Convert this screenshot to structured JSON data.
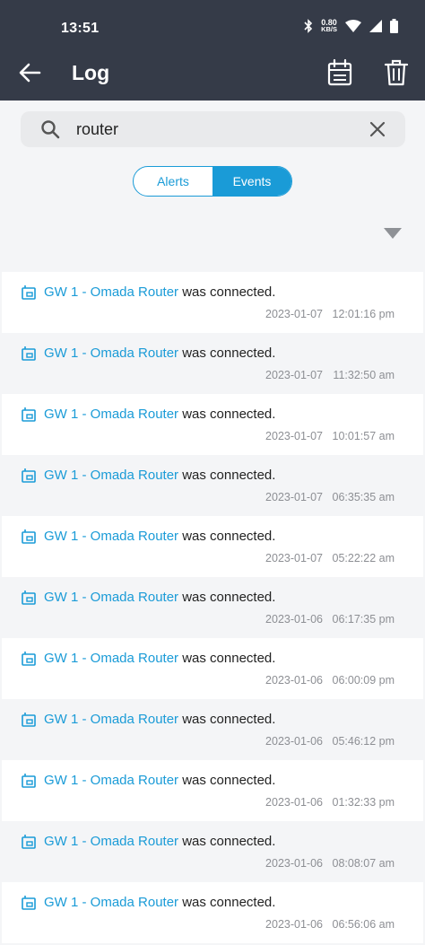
{
  "status_bar": {
    "time": "13:51",
    "speed_value": "0.80",
    "speed_unit": "KB/S"
  },
  "header": {
    "title": "Log"
  },
  "search": {
    "value": "router"
  },
  "tabs": [
    {
      "label": "Alerts"
    },
    {
      "label": "Events"
    }
  ],
  "colors": {
    "appbar": "#353b48",
    "accent": "#1a9bd7",
    "text": "#222222",
    "muted": "#8d8f94"
  },
  "events": [
    {
      "device": "GW 1 - Omada Router",
      "message": " was connected.",
      "date": "2023-01-07",
      "time": "12:01:16 pm"
    },
    {
      "device": "GW 1 - Omada Router",
      "message": " was connected.",
      "date": "2023-01-07",
      "time": "11:32:50 am"
    },
    {
      "device": "GW 1 - Omada Router",
      "message": " was connected.",
      "date": "2023-01-07",
      "time": "10:01:57 am"
    },
    {
      "device": "GW 1 - Omada Router",
      "message": " was connected.",
      "date": "2023-01-07",
      "time": "06:35:35 am"
    },
    {
      "device": "GW 1 - Omada Router",
      "message": " was connected.",
      "date": "2023-01-07",
      "time": "05:22:22 am"
    },
    {
      "device": "GW 1 - Omada Router",
      "message": " was connected.",
      "date": "2023-01-06",
      "time": "06:17:35 pm"
    },
    {
      "device": "GW 1 - Omada Router",
      "message": " was connected.",
      "date": "2023-01-06",
      "time": "06:00:09 pm"
    },
    {
      "device": "GW 1 - Omada Router",
      "message": " was connected.",
      "date": "2023-01-06",
      "time": "05:46:12 pm"
    },
    {
      "device": "GW 1 - Omada Router",
      "message": " was connected.",
      "date": "2023-01-06",
      "time": "01:32:33 pm"
    },
    {
      "device": "GW 1 - Omada Router",
      "message": " was connected.",
      "date": "2023-01-06",
      "time": "08:08:07 am"
    },
    {
      "device": "GW 1 - Omada Router",
      "message": " was connected.",
      "date": "2023-01-06",
      "time": "06:56:06 am"
    }
  ]
}
